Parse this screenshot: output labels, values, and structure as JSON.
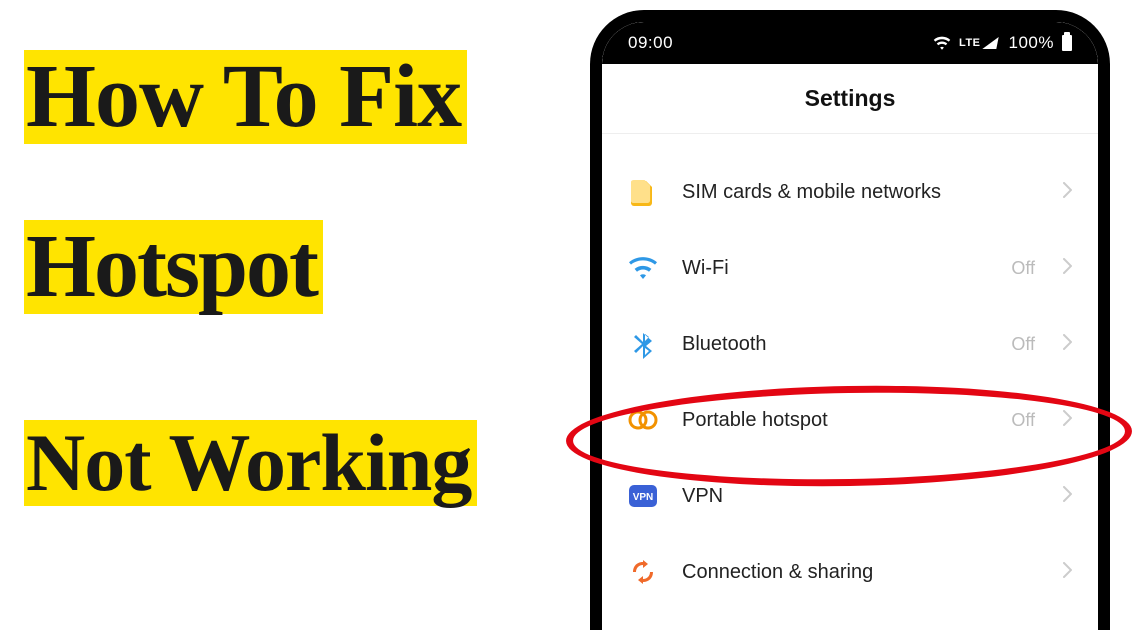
{
  "headline": {
    "line1": "How To Fix",
    "line2": "Hotspot",
    "line3": "Not Working"
  },
  "statusbar": {
    "time": "09:00",
    "network_label": "LTE",
    "battery": "100%"
  },
  "settings": {
    "title": "Settings",
    "rows": [
      {
        "key": "sim",
        "label": "SIM cards & mobile networks",
        "value": ""
      },
      {
        "key": "wifi",
        "label": "Wi-Fi",
        "value": "Off"
      },
      {
        "key": "bluetooth",
        "label": "Bluetooth",
        "value": "Off"
      },
      {
        "key": "hotspot",
        "label": "Portable hotspot",
        "value": "Off"
      },
      {
        "key": "vpn",
        "label": "VPN",
        "value": ""
      },
      {
        "key": "share",
        "label": "Connection & sharing",
        "value": ""
      }
    ]
  },
  "highlight_row": "hotspot",
  "colors": {
    "accent_yellow": "#ffe400",
    "circle_red": "#e30613"
  }
}
